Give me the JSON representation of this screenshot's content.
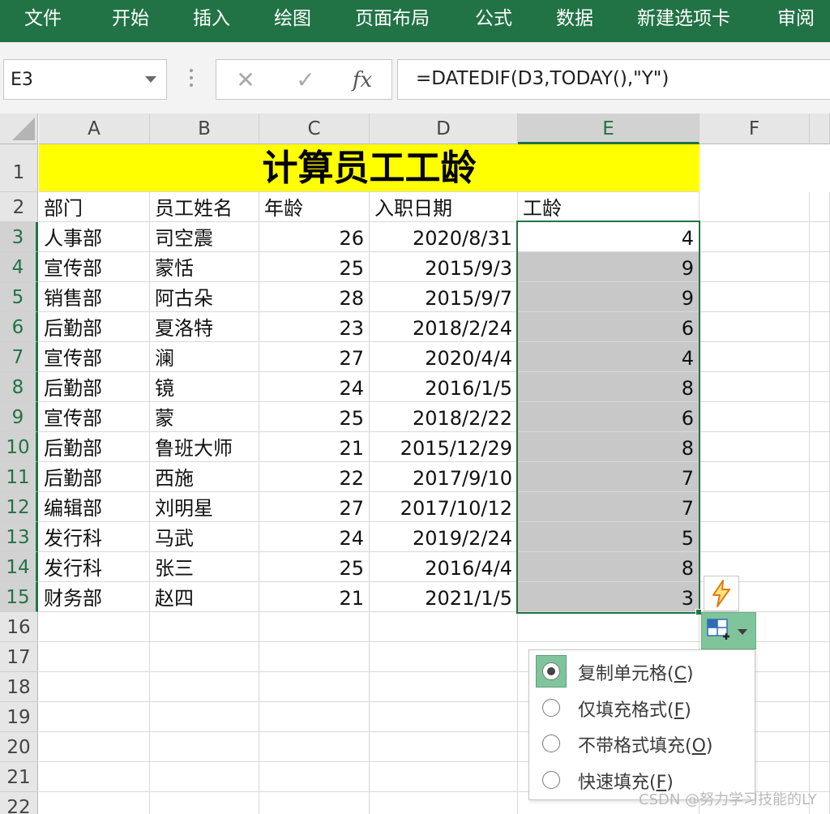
{
  "ribbon": {
    "tabs": [
      "文件",
      "开始",
      "插入",
      "绘图",
      "页面布局",
      "公式",
      "数据",
      "新建选项卡",
      "审阅"
    ]
  },
  "formula_bar": {
    "name_box": "E3",
    "cancel_icon": "✕",
    "enter_icon": "✓",
    "fx_label": "fx",
    "formula": "=DATEDIF(D3,TODAY(),\"Y\")"
  },
  "columns": [
    "A",
    "B",
    "C",
    "D",
    "E",
    "F"
  ],
  "selected_column": "E",
  "rows": [
    "1",
    "2",
    "3",
    "4",
    "5",
    "6",
    "7",
    "8",
    "9",
    "10",
    "11",
    "12",
    "13",
    "14",
    "15",
    "16",
    "17",
    "18",
    "19",
    "20",
    "21",
    "22"
  ],
  "sheet": {
    "title": "计算员工工龄",
    "headers": [
      "部门",
      "员工姓名",
      "年龄",
      "入职日期",
      "工龄"
    ],
    "records": [
      [
        "人事部",
        "司空震",
        "26",
        "2020/8/31",
        "4"
      ],
      [
        "宣传部",
        "蒙恬",
        "25",
        "2015/9/3",
        "9"
      ],
      [
        "销售部",
        "阿古朵",
        "28",
        "2015/9/7",
        "9"
      ],
      [
        "后勤部",
        "夏洛特",
        "23",
        "2018/2/24",
        "6"
      ],
      [
        "宣传部",
        "澜",
        "27",
        "2020/4/4",
        "4"
      ],
      [
        "后勤部",
        "镜",
        "24",
        "2016/1/5",
        "8"
      ],
      [
        "宣传部",
        "蒙",
        "25",
        "2018/2/22",
        "6"
      ],
      [
        "后勤部",
        "鲁班大师",
        "21",
        "2015/12/29",
        "8"
      ],
      [
        "后勤部",
        "西施",
        "22",
        "2017/9/10",
        "7"
      ],
      [
        "编辑部",
        "刘明星",
        "27",
        "2017/10/12",
        "7"
      ],
      [
        "发行科",
        "马武",
        "24",
        "2019/2/24",
        "5"
      ],
      [
        "发行科",
        "张三",
        "25",
        "2016/4/4",
        "8"
      ],
      [
        "财务部",
        "赵四",
        "21",
        "2021/1/5",
        "3"
      ]
    ]
  },
  "autofill_menu": {
    "items": [
      {
        "label": "复制单元格(",
        "key": "C",
        "close": ")",
        "checked": true
      },
      {
        "label": "仅填充格式(",
        "key": "F",
        "close": ")",
        "checked": false
      },
      {
        "label": "不带格式填充(",
        "key": "O",
        "close": ")",
        "checked": false
      },
      {
        "label": "快速填充(",
        "key": "F",
        "close": ")",
        "checked": false
      }
    ]
  },
  "watermark": "CSDN @努力学习技能的LY",
  "colors": {
    "ribbon": "#217346",
    "title_fill": "#ffff00",
    "selection_fill": "#c8c8c8",
    "accent": "#217346",
    "menu_highlight": "#80c49c"
  },
  "icons": {
    "flash_fill": "lightning-icon",
    "autofill_options": "paste-options-icon"
  }
}
